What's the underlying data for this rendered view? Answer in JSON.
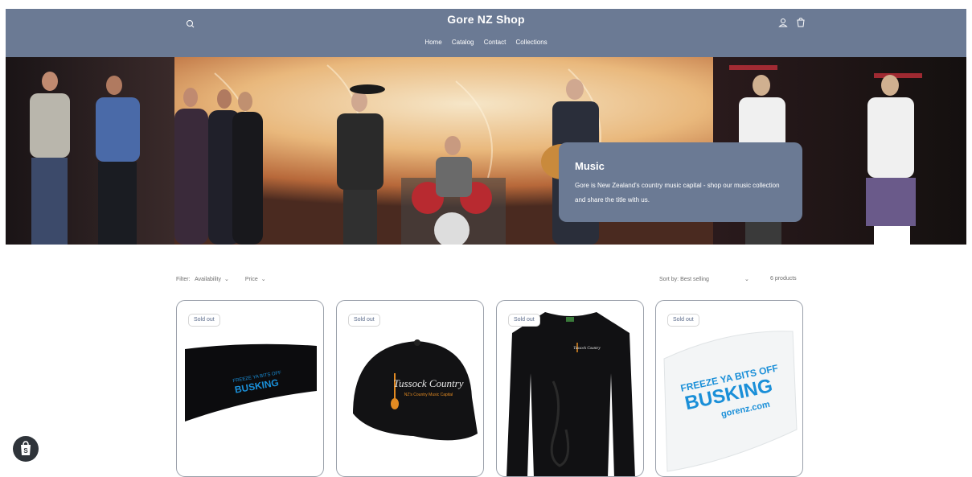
{
  "header": {
    "title": "Gore NZ Shop",
    "nav": [
      "Home",
      "Catalog",
      "Contact",
      "Collections"
    ]
  },
  "hero": {
    "title": "Music",
    "text": "Gore is New Zealand's country music capital - shop our music collection and share the title with us."
  },
  "filter": {
    "label": "Filter:",
    "availability": "Availability",
    "price": "Price"
  },
  "sort": {
    "label": "Sort by:",
    "value": "Best selling",
    "count": "6 products"
  },
  "products": [
    {
      "badge": "Sold out",
      "print_line1": "FREEZE YA BITS OFF",
      "print_line2": "BUSKING"
    },
    {
      "badge": "Sold out",
      "print_line1": "Tussock Country",
      "print_line2": "NZ's Country Music Capital"
    },
    {
      "badge": "Sold out",
      "print_line1": "Tussock Country",
      "print_line2": ""
    },
    {
      "badge": "Sold out",
      "print_line1": "FREEZE YA BITS OFF",
      "print_line2": "BUSKING",
      "print_line3": "gorenz.com"
    }
  ],
  "colors": {
    "header_bg": "#6b7a94",
    "card_border": "#9aa0aa",
    "badge_text": "#5a6a8a",
    "print_blue": "#1a8fd8"
  },
  "icons": [
    "search-icon",
    "account-icon",
    "cart-icon",
    "chevron-down-icon",
    "shopify-icon"
  ]
}
